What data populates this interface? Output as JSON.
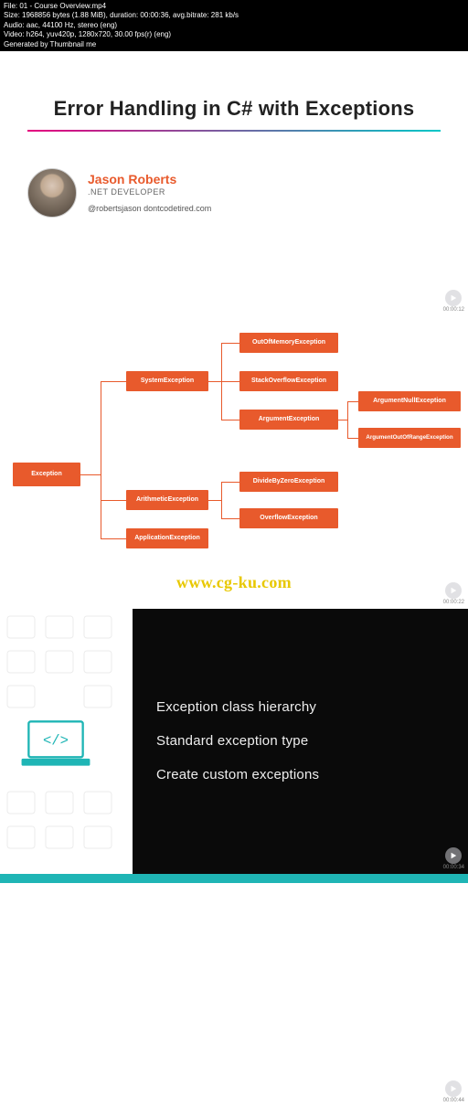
{
  "metadata": {
    "file": "File: 01 - Course Overview.mp4",
    "size": "Size: 1968856 bytes (1.88 MiB), duration: 00:00:36, avg.bitrate: 281 kb/s",
    "audio": "Audio: aac, 44100 Hz, stereo (eng)",
    "video": "Video: h264, yuv420p, 1280x720, 30.00 fps(r) (eng)",
    "generated": "Generated by Thumbnail me"
  },
  "slide1": {
    "title": "Error Handling in C# with Exceptions",
    "author_name": "Jason Roberts",
    "author_role": ".NET DEVELOPER",
    "author_social": "@robertsjason   dontcodetired.com",
    "timestamp": "00:00:12"
  },
  "slide2": {
    "timestamp": "00:00:22",
    "tree": {
      "root": "Exception",
      "l1_a": "SystemException",
      "l1_b": "ArithmeticException",
      "l1_c": "ApplicationException",
      "l2_a": "OutOfMemoryException",
      "l2_b": "StackOverflowException",
      "l2_c": "ArgumentException",
      "l2_d": "DivideByZeroException",
      "l2_e": "OverflowException",
      "l3_a": "ArgumentNullException",
      "l3_b": "ArgumentOutOfRangeException"
    }
  },
  "watermark": "www.cg-ku.com",
  "slide3": {
    "line1": "Exception class hierarchy",
    "line2": "Standard exception type",
    "line3": "Create custom exceptions",
    "timestamp": "00:00:34"
  },
  "slide4": {
    "timestamp": "00:00:44"
  },
  "colors": {
    "accent": "#e85a2c",
    "teal": "#1fb5b5",
    "watermark": "#e8c800"
  }
}
